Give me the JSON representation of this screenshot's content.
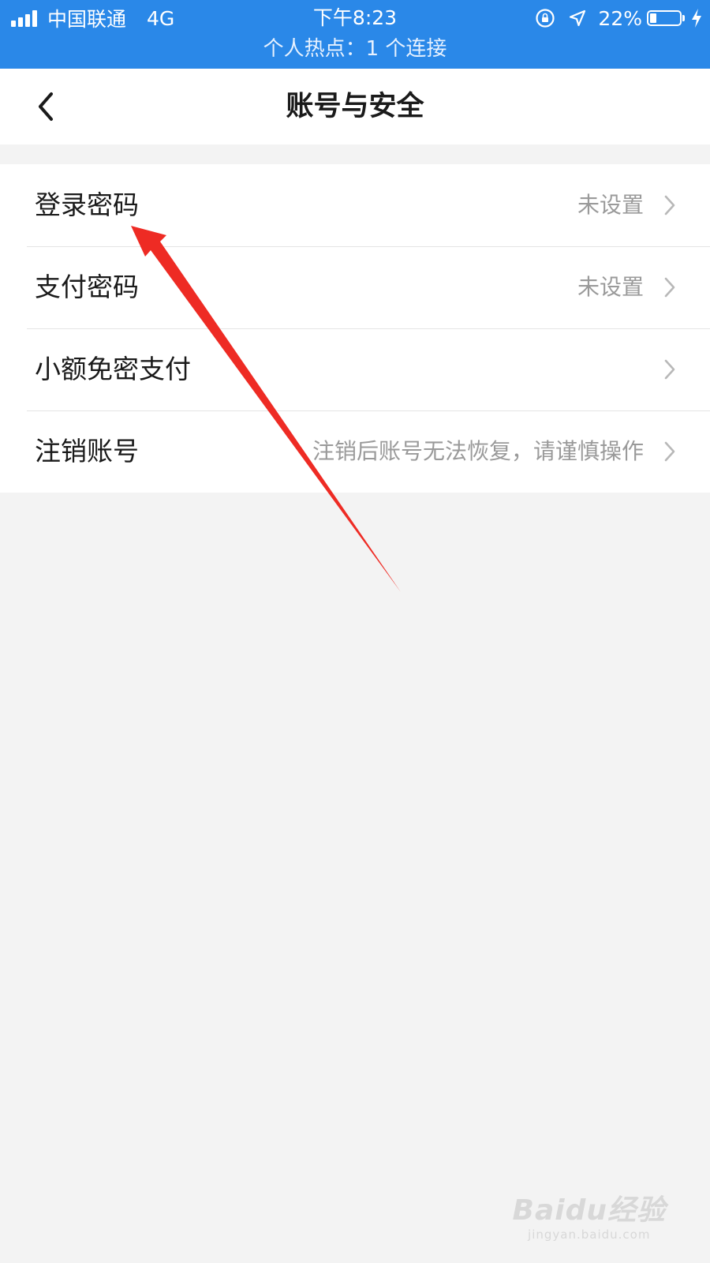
{
  "status_bar": {
    "carrier": "中国联通",
    "network": "4G",
    "time": "下午8:23",
    "battery": "22%",
    "hotspot": "个人热点：1 个连接",
    "signal_icon": "signal-bars-icon",
    "lock_icon": "orientation-lock-icon",
    "location_icon": "location-arrow-icon",
    "charging_icon": "lightning-icon",
    "battery_level": 0.22
  },
  "nav": {
    "back_icon": "chevron-left-icon",
    "title": "账号与安全"
  },
  "list": [
    {
      "label": "登录密码",
      "value": "未设置"
    },
    {
      "label": "支付密码",
      "value": "未设置"
    },
    {
      "label": "小额免密支付",
      "value": ""
    },
    {
      "label": "注销账号",
      "value": "注销后账号无法恢复，请谨慎操作"
    }
  ],
  "watermark": {
    "logo": "Baidu经验",
    "url": "jingyan.baidu.com"
  },
  "colors": {
    "status_bar_bg": "#2a88e8",
    "page_bg": "#f3f3f3",
    "annotation": "#ee2b24"
  }
}
